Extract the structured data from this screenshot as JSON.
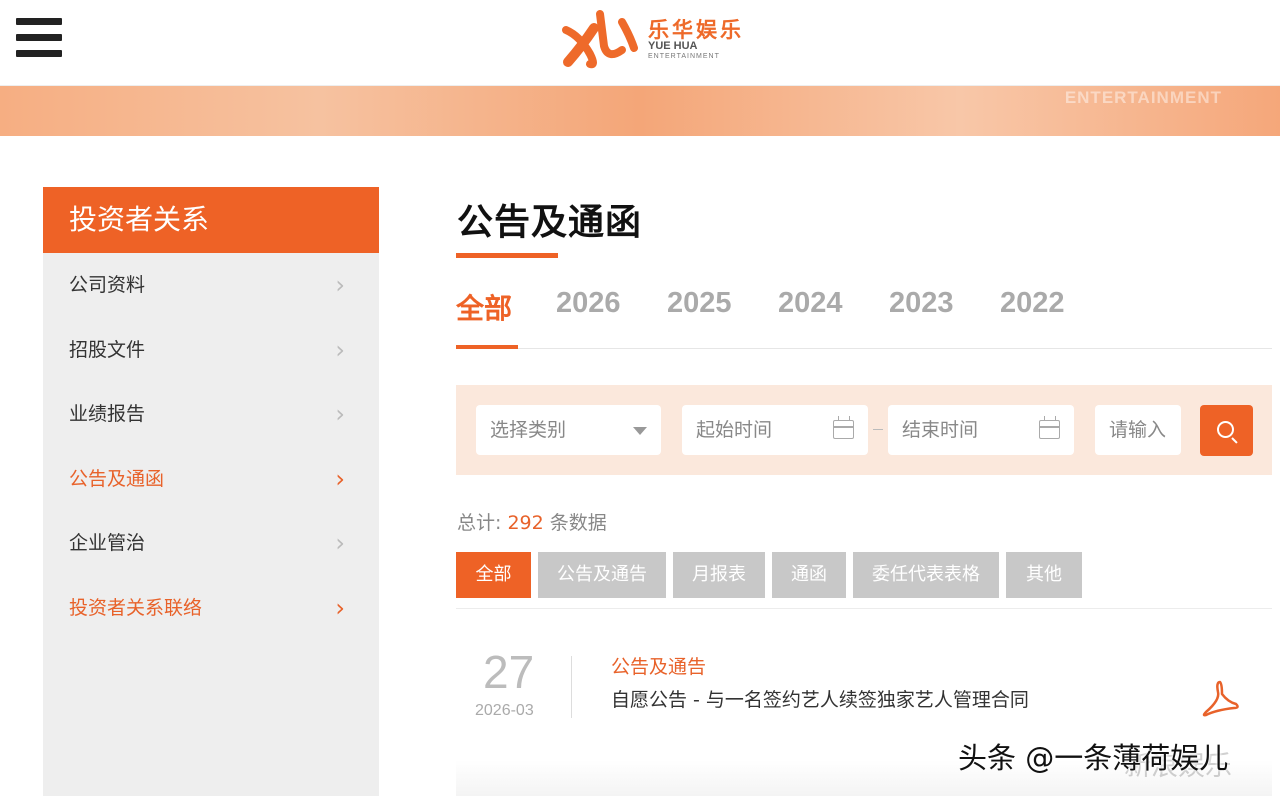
{
  "header": {
    "logo_cn": "乐华娱乐",
    "logo_en_line1": "YUE HUA",
    "logo_en_line2": "ENTERTAINMENT",
    "brand_color": "#ee6226"
  },
  "banner": {
    "text": "ENTERTAINMENT"
  },
  "sidebar": {
    "title": "投资者关系",
    "items": [
      {
        "label": "公司资料",
        "active": false
      },
      {
        "label": "招股文件",
        "active": false
      },
      {
        "label": "业绩报告",
        "active": false
      },
      {
        "label": "公告及通函",
        "active": true
      },
      {
        "label": "企业管治",
        "active": false
      },
      {
        "label": "投资者关系联络",
        "active": true
      }
    ]
  },
  "main": {
    "title": "公告及通函",
    "year_tabs": [
      "全部",
      "2026",
      "2025",
      "2024",
      "2023",
      "2022"
    ],
    "filter": {
      "category_placeholder": "选择类别",
      "start_placeholder": "起始时间",
      "end_placeholder": "结束时间",
      "keyword_placeholder": "请输入"
    },
    "total": {
      "prefix": "总计:",
      "count": "292",
      "suffix": "条数据"
    },
    "categories": [
      "全部",
      "公告及通告",
      "月报表",
      "通函",
      "委任代表表格",
      "其他"
    ],
    "announcements": [
      {
        "day": "27",
        "month": "2026-03",
        "category": "公告及通告",
        "title": "自愿公告 - 与一名签约艺人续签独家艺人管理合同"
      }
    ]
  },
  "watermark": {
    "text": "头条 @一条薄荷娱儿",
    "ghost": "新浪娱乐"
  }
}
